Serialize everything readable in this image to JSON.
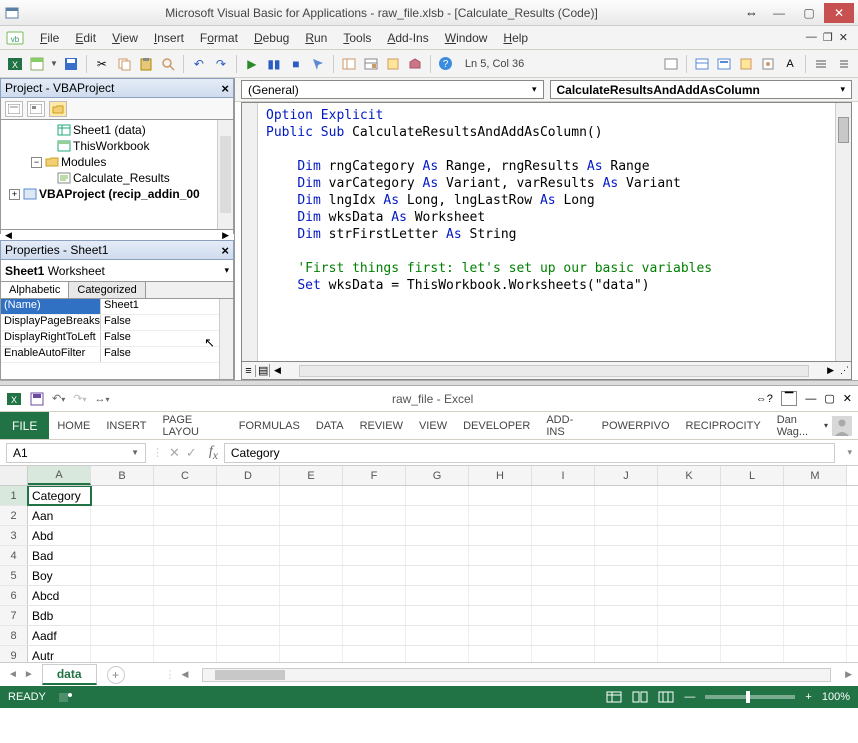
{
  "vbe": {
    "title": "Microsoft Visual Basic for Applications - raw_file.xlsb - [Calculate_Results (Code)]",
    "menus": [
      "File",
      "Edit",
      "View",
      "Insert",
      "Format",
      "Debug",
      "Run",
      "Tools",
      "Add-Ins",
      "Window",
      "Help"
    ],
    "cursor_status": "Ln 5, Col 36",
    "project_panel_title": "Project - VBAProject",
    "tree": {
      "sheet1": "Sheet1 (data)",
      "thiswb": "ThisWorkbook",
      "modules": "Modules",
      "module1": "Calculate_Results",
      "addin": "VBAProject (recip_addin_00"
    },
    "properties_panel_title": "Properties - Sheet1",
    "prop_combo_bold": "Sheet1",
    "prop_combo_rest": " Worksheet",
    "prop_tabs": {
      "a": "Alphabetic",
      "b": "Categorized"
    },
    "props": [
      {
        "name": "(Name)",
        "value": "Sheet1"
      },
      {
        "name": "DisplayPageBreaks",
        "value": "False"
      },
      {
        "name": "DisplayRightToLeft",
        "value": "False"
      },
      {
        "name": "EnableAutoFilter",
        "value": "False"
      }
    ],
    "combo_left": "(General)",
    "combo_right": "CalculateResultsAndAddAsColumn",
    "code": {
      "l1a": "Option Explicit",
      "l2a": "Public Sub",
      "l2b": " CalculateResultsAndAddAsColumn()",
      "l4a": "Dim",
      "l4b": " rngCategory ",
      "l4c": "As",
      "l4d": " Range, rngResults ",
      "l4e": "As",
      "l4f": " Range",
      "l5a": "Dim",
      "l5b": " varCategory ",
      "l5c": "As",
      "l5d": " Variant, varResults ",
      "l5e": "As",
      "l5f": " Variant",
      "l6a": "Dim",
      "l6b": " lngIdx ",
      "l6c": "As",
      "l6d": " Long, lngLastRow ",
      "l6e": "As",
      "l6f": " Long",
      "l7a": "Dim",
      "l7b": " wksData ",
      "l7c": "As",
      "l7d": " Worksheet",
      "l8a": "Dim",
      "l8b": " strFirstLetter ",
      "l8c": "As",
      "l8d": " String",
      "l10": "'First things first: let's set up our basic variables",
      "l11a": "Set",
      "l11b": " wksData = ThisWorkbook.Worksheets(\"data\")"
    }
  },
  "excel": {
    "title": "raw_file - Excel",
    "ribbon": [
      "HOME",
      "INSERT",
      "PAGE LAYOU",
      "FORMULAS",
      "DATA",
      "REVIEW",
      "VIEW",
      "DEVELOPER",
      "ADD-INS",
      "POWERPIVO",
      "RECIPROCITY"
    ],
    "file_tab": "FILE",
    "user": "Dan Wag...",
    "namebox": "A1",
    "formula": "Category",
    "columns": [
      "A",
      "B",
      "C",
      "D",
      "E",
      "F",
      "G",
      "H",
      "I",
      "J",
      "K",
      "L",
      "M"
    ],
    "rows": [
      {
        "n": "1",
        "a": "Category"
      },
      {
        "n": "2",
        "a": "Aan"
      },
      {
        "n": "3",
        "a": "Abd"
      },
      {
        "n": "4",
        "a": "Bad"
      },
      {
        "n": "5",
        "a": "Boy"
      },
      {
        "n": "6",
        "a": "Abcd"
      },
      {
        "n": "7",
        "a": "Bdb"
      },
      {
        "n": "8",
        "a": "Aadf"
      },
      {
        "n": "9",
        "a": "Autr"
      }
    ],
    "sheet_tab": "data",
    "status": "READY",
    "zoom": "100%"
  }
}
